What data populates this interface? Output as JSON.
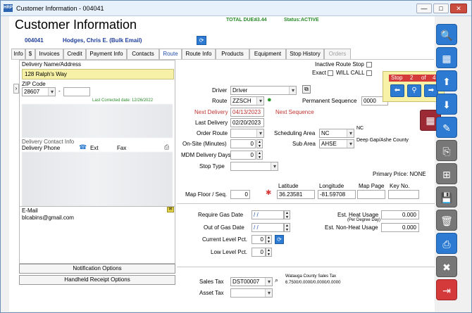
{
  "window": {
    "title": "Customer Information - 004041",
    "app_icon_text": "HRP",
    "minimize": "—",
    "maximize": "□",
    "close": "✕"
  },
  "header": {
    "title": "Customer Information",
    "total_due_label": "TOTAL DUE:",
    "total_due_value": "43.44",
    "status_label": "Status:",
    "status_value": "ACTIVE",
    "account_number": "004041",
    "customer_name": "Hodges, Chris E. (Bulk Email)"
  },
  "tabs": [
    {
      "label": "Info"
    },
    {
      "label": "$"
    },
    {
      "label": "Invoices"
    },
    {
      "label": "Credit"
    },
    {
      "label": "Payment Info"
    },
    {
      "label": "Contacts"
    },
    {
      "label": "Route"
    },
    {
      "label": "Route Info"
    },
    {
      "label": "Products"
    },
    {
      "label": "Equipment"
    },
    {
      "label": "Stop History"
    },
    {
      "label": "Orders"
    }
  ],
  "delivery": {
    "name_address_label": "Delivery Name/Address",
    "address_line": "128 Ralph's Way",
    "zip_label": "ZIP Code",
    "zip_value": "28607",
    "zip_dash": "-",
    "last_corrected": "Last Corrected date: 12/26/2022",
    "contact_info_label": "Delivery Contact Info",
    "phone_label": "Delivery Phone",
    "ext_label": "Ext",
    "fax_label": "Fax",
    "expand_arrow": "›"
  },
  "email": {
    "label": "E-Mail",
    "value": "blcabins@gmail.com"
  },
  "buttons": {
    "notification_options": "Notification Options",
    "handheld_receipt_options": "Handheld Receipt Options"
  },
  "route": {
    "inactive_route_stop_label": "Inactive Route Stop",
    "exact_label": "Exact",
    "will_call_label": "WILL CALL",
    "driver_label": "Driver",
    "driver_value": "Driver",
    "route_label": "Route",
    "route_value": "ZZSCH",
    "permanent_sequence_label": "Permanent Sequence",
    "permanent_sequence_value": "0000",
    "next_delivery_label": "Next Delivery",
    "next_delivery_value": "04/13/2023",
    "next_sequence_label": "Next Sequence",
    "last_delivery_label": "Last Delivery",
    "last_delivery_value": "02/20/2023",
    "order_route_label": "Order Route",
    "scheduling_area_label": "Scheduling Area",
    "scheduling_area_value": "NC",
    "scheduling_area_desc": "NC",
    "onsite_label": "On-Site (Minutes)",
    "onsite_value": "0",
    "sub_area_label": "Sub Area",
    "sub_area_value": "AHSE",
    "sub_area_desc": "Deep Gap/Ashe County",
    "mdm_label": "MDM Delivery Days",
    "mdm_value": "0",
    "stop_type_label": "Stop Type",
    "primary_price_label": "Primary Price: NONE",
    "latitude_label": "Latitude",
    "longitude_label": "Longitude",
    "map_page_label": "Map Page",
    "key_no_label": "Key No.",
    "map_floor_label": "Map Floor / Seq.",
    "map_floor_value": "0",
    "latitude_value": "36.23581",
    "longitude_value": "-81.59708"
  },
  "stop_nav": {
    "stop_label": "Stop",
    "current": "2",
    "of_label": "of",
    "total": "4"
  },
  "gas": {
    "require_gas_date_label": "Require Gas Date",
    "require_gas_date_value": " / /",
    "out_of_gas_date_label": "Out of Gas Date",
    "out_of_gas_date_value": " / /",
    "current_level_label": "Current Level Pct.",
    "current_level_value": "0",
    "low_level_label": "Low Level Pct.",
    "low_level_value": "0",
    "est_heat_label": "Est. Heat Usage",
    "est_heat_sub": "(Per Degree Day)",
    "est_heat_value": "0.000",
    "est_nonheat_label": "Est. Non-Heat Usage",
    "est_nonheat_value": "0.000"
  },
  "tax": {
    "sales_tax_label": "Sales Tax",
    "sales_tax_value": "DST00007",
    "sales_tax_desc1": "Watauga County Sales Tax",
    "sales_tax_desc2": "6.7500/0.0000/0.0000/0.0000",
    "asset_tax_label": "Asset Tax"
  },
  "sidebar": [
    {
      "name": "search-button",
      "icon": "🔍"
    },
    {
      "name": "grid-button",
      "icon": "▦"
    },
    {
      "name": "up-button",
      "icon": "⬆"
    },
    {
      "name": "down-button",
      "icon": "⬇"
    },
    {
      "name": "edit-button",
      "icon": "✎"
    },
    {
      "name": "copy-button",
      "icon": "⎘"
    },
    {
      "name": "add-button",
      "icon": "⊞"
    },
    {
      "name": "save-button",
      "icon": "💾"
    },
    {
      "name": "delete-button",
      "icon": "🗑"
    },
    {
      "name": "print-button",
      "icon": "⎙"
    },
    {
      "name": "cancel-button",
      "icon": "✖"
    },
    {
      "name": "exit-button",
      "icon": "⇥"
    }
  ],
  "colors": {
    "accent_blue": "#2c7ad1",
    "highlight_yellow": "#f6f1a6",
    "alert_red": "#c0312f"
  }
}
